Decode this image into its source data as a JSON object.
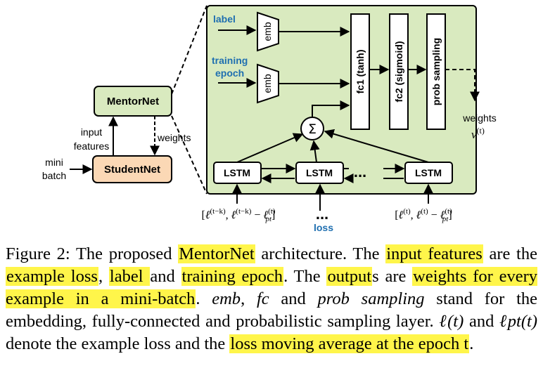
{
  "diagram": {
    "mentornet": "MentorNet",
    "studentnet": "StudentNet",
    "input_features_line1": "input",
    "input_features_line2": "features",
    "weights_left": "weights",
    "mini_line1": "mini",
    "mini_line2": "batch",
    "label": "label",
    "training_line1": "training",
    "training_line2": "epoch",
    "emb": "emb",
    "fc1": "fc1 (tanh)",
    "fc2": "fc2 (sigmoid)",
    "prob": "prob sampling",
    "sigma": "Σ",
    "lstm": "LSTM",
    "dots": "...",
    "loss": "loss",
    "weights_right": "weights",
    "v_t": "v(t)",
    "input_left": "[ℓ(t−k), ℓ(t−k) − ℓpt(t)]",
    "input_right": "[ℓ(t), ℓ(t) − ℓpt(t)]"
  },
  "caption": {
    "p01": "Figure 2: The proposed ",
    "h01": "MentorNet",
    "p02": " architecture.  The ",
    "h02": "input features",
    "p03": " are the ",
    "h03": "example loss",
    "p04": ", ",
    "h04": "label ",
    "p05": "and ",
    "h05": "training epoch",
    "p06": ". The ",
    "h06": "output",
    "p07": "s are ",
    "h07": "weights for every example in a mini-batch",
    "p08": ". ",
    "i01": "emb",
    "p09": ", ",
    "i02": "fc",
    "p10": " and ",
    "i03": "prob sampling",
    "p11": " stand for the embedding, fully-connected and probabilistic sampling layer. ",
    "m01": "ℓ(t)",
    "p12": " and ",
    "m02": "ℓpt(t)",
    "p13": " denote the example loss and the ",
    "h08": "loss moving average at the epoch t",
    "p14": "."
  },
  "colors": {
    "green": "#d9eabf",
    "orange": "#fbd8b5",
    "blue": "#1f6fb0",
    "highlight": "#fff54a"
  }
}
